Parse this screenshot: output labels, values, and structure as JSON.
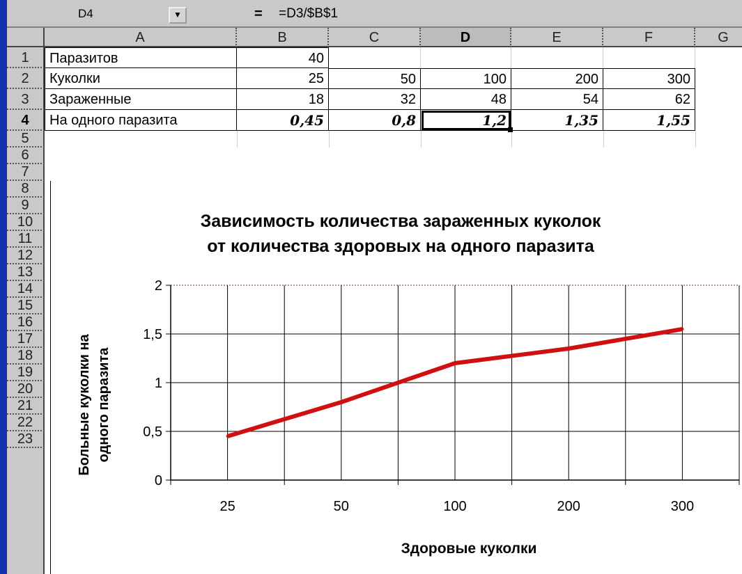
{
  "formula_bar": {
    "cell_reference": "D4",
    "equals": "=",
    "formula": "=D3/$B$1"
  },
  "columns": [
    "A",
    "B",
    "C",
    "D",
    "E",
    "F",
    "G"
  ],
  "rows": [
    "1",
    "2",
    "3",
    "4",
    "5",
    "6",
    "7",
    "8",
    "9",
    "10",
    "11",
    "12",
    "13",
    "14",
    "15",
    "16",
    "17",
    "18",
    "19",
    "20",
    "21",
    "22",
    "23"
  ],
  "active_cell": {
    "column": "D",
    "row": "4"
  },
  "table": [
    {
      "label": "Паразитов",
      "values": [
        "40",
        "",
        "",
        "",
        ""
      ]
    },
    {
      "label": "Куколки",
      "values": [
        "25",
        "50",
        "100",
        "200",
        "300"
      ]
    },
    {
      "label": "Зараженные",
      "values": [
        "18",
        "32",
        "48",
        "54",
        "62"
      ]
    },
    {
      "label": "На одного паразита",
      "values": [
        "0,45",
        "0,8",
        "1,2",
        "1,35",
        "1,55"
      ]
    }
  ],
  "chart_data": {
    "type": "line",
    "title_line1": "Зависимость количества зараженных куколок",
    "title_line2": "от количества здоровых на одного паразита",
    "xlabel": "Здоровые куколки",
    "ylabel_line1": "Больные куколки на",
    "ylabel_line2": "одного паразита",
    "categories": [
      "25",
      "50",
      "100",
      "200",
      "300"
    ],
    "y_tick_labels": [
      "0",
      "0,5",
      "1",
      "1,5",
      "2"
    ],
    "ylim": [
      0,
      2
    ],
    "grid": true,
    "series": [
      {
        "values": [
          0.45,
          0.8,
          1.2,
          1.35,
          1.55
        ],
        "color": "#d01010"
      }
    ]
  }
}
